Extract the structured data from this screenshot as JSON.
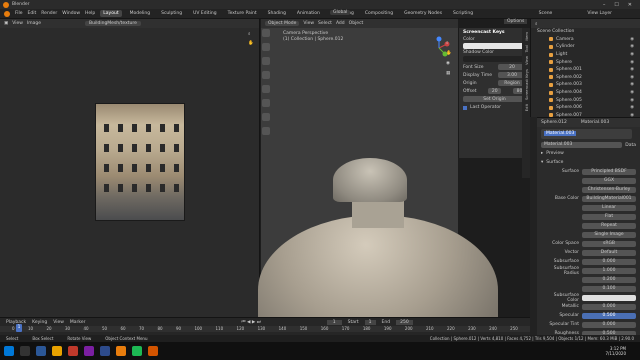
{
  "window": {
    "title": "Blender"
  },
  "menu": {
    "items": [
      "File",
      "Edit",
      "Render",
      "Window",
      "Help"
    ]
  },
  "workspaces": [
    "Layout",
    "Modeling",
    "Sculpting",
    "UV Editing",
    "Texture Paint",
    "Shading",
    "Animation",
    "Rendering",
    "Compositing",
    "Geometry Nodes",
    "Scripting"
  ],
  "scene": {
    "scene_label": "Scene",
    "view_layer": "View Layer"
  },
  "image_editor": {
    "menu": [
      "View",
      "Image"
    ],
    "image_name": "BuildingMesh/texture"
  },
  "viewport": {
    "mode": "Object Mode",
    "menu": [
      "View",
      "Select",
      "Add",
      "Object"
    ],
    "transform": "Global",
    "view_name": "Camera Perspective",
    "collection": "(1) Collection | Sphere.012",
    "options": "Options"
  },
  "npanel": {
    "title": "Screencast Keys",
    "color_label": "Color",
    "shadow_label": "Shadow Color",
    "font_size": "Font Size",
    "font_size_val": "20",
    "display_time": "Display Time",
    "display_time_val": "3.00",
    "origin": "Origin",
    "origin_val": "Region",
    "offset": "Offset",
    "off_x": "20",
    "off_y": "80",
    "set_origin": "Set Origin",
    "last_op": "Last Operator",
    "tabs": [
      "Item",
      "Tool",
      "View",
      "Screencast Keys",
      "Edit"
    ]
  },
  "outliner": {
    "root": "Scene Collection",
    "items": [
      "Camera",
      "Cylinder",
      "Light",
      "Sphere",
      "Sphere.001",
      "Sphere.002",
      "Sphere.003",
      "Sphere.004",
      "Sphere.005",
      "Sphere.006",
      "Sphere.007"
    ]
  },
  "props": {
    "object": "Sphere.012",
    "material_slot": "Material.003",
    "material_name": "Material.003",
    "data": "Data",
    "preview": "Preview",
    "surface": "Surface",
    "surface_shader": "Principled BSDF",
    "rows": [
      {
        "label": "Surface",
        "value": "Principled BSDF"
      },
      {
        "label": "",
        "value": "GGX"
      },
      {
        "label": "",
        "value": "Christensen-Burley"
      },
      {
        "label": "Base Color",
        "value": "BuildingMaterial001"
      },
      {
        "label": "",
        "value": "Linear"
      },
      {
        "label": "",
        "value": "Flat"
      },
      {
        "label": "",
        "value": "Repeat"
      },
      {
        "label": "",
        "value": "Single Image"
      },
      {
        "label": "Color Space",
        "value": "sRGB"
      },
      {
        "label": "Vector",
        "value": "Default"
      },
      {
        "label": "Subsurface",
        "value": "0.000"
      },
      {
        "label": "Subsurface Radius",
        "value": "1.000"
      },
      {
        "label": "",
        "value": "0.200"
      },
      {
        "label": "",
        "value": "0.100"
      },
      {
        "label": "Subsurface Color",
        "value": ""
      },
      {
        "label": "Metallic",
        "value": "0.000"
      },
      {
        "label": "Specular",
        "value": "0.500"
      },
      {
        "label": "Specular Tint",
        "value": "0.000"
      },
      {
        "label": "Roughness",
        "value": "0.500"
      }
    ]
  },
  "timeline": {
    "menu": [
      "Playback",
      "Keying",
      "View",
      "Marker"
    ],
    "current_frame": "1",
    "start": "Start",
    "start_val": "1",
    "end": "End",
    "end_val": "250",
    "ticks": [
      "0",
      "10",
      "20",
      "30",
      "40",
      "50",
      "60",
      "70",
      "80",
      "90",
      "100",
      "110",
      "120",
      "130",
      "140",
      "150",
      "160",
      "170",
      "180",
      "190",
      "200",
      "210",
      "220",
      "230",
      "240",
      "250"
    ]
  },
  "status": {
    "select": "Select",
    "box": "Box Select",
    "rotate": "Rotate View",
    "menu": "Object Context Menu",
    "stats": "Collection | Sphere.012 | Verts 4,810 | Faces 4,752 | Tris 9,504 | Objects 1/12 | Mem: 60.3 MiB | 2.90.0"
  },
  "taskbar": {
    "time": "3:12 PM",
    "date": "7/11/2020"
  },
  "colors": {
    "accent": "#4a72c4",
    "orange": "#e87d0d"
  }
}
